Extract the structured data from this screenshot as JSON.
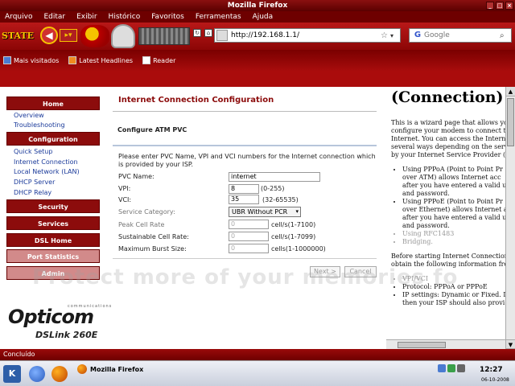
{
  "window": {
    "title": "Mozilla Firefox"
  },
  "menu": [
    "Arquivo",
    "Editar",
    "Exibir",
    "Histórico",
    "Favoritos",
    "Ferramentas",
    "Ajuda"
  ],
  "toolbar": {
    "logo_text": "STATE",
    "url": "http://192.168.1.1/",
    "search_placeholder": "Google"
  },
  "bookmarks": [
    {
      "label": "Mais visitados",
      "icon": "bookmark-folder-icon"
    },
    {
      "label": "Latest Headlines",
      "icon": "rss-icon"
    },
    {
      "label": "Reader",
      "icon": "page-icon"
    }
  ],
  "sidebar": {
    "home": "Home",
    "home_links": [
      "Overview",
      "Troubleshooting"
    ],
    "configuration": "Configuration",
    "config_links": [
      "Quick Setup",
      "Internet Connection",
      "Local Network (LAN)",
      "DHCP Server",
      "DHCP Relay"
    ],
    "security": "Security",
    "services": "Services",
    "dsl_home": "DSL Home",
    "port_statistics": "Port Statistics",
    "admin": "Admin"
  },
  "logo": {
    "brand": "Opticom",
    "sub": "communications",
    "model": "DSLink 260E"
  },
  "main": {
    "title": "Internet Connection Configuration",
    "section": "Configure ATM PVC",
    "intro": "Please enter PVC Name, VPI and VCI numbers for the Internet connection which is provided by your ISP.",
    "fields": {
      "pvc_name": {
        "label": "PVC Name:",
        "value": "internet"
      },
      "vpi": {
        "label": "VPI:",
        "value": "8",
        "hint": "(0-255)"
      },
      "vci": {
        "label": "VCI:",
        "value": "35",
        "hint": "(32-65535)"
      },
      "service_category": {
        "label": "Service Category:",
        "value": "UBR Without PCR"
      },
      "peak_cell_rate": {
        "label": "Peak Cell Rate",
        "value": "0",
        "hint": "cell/s(1-7100)"
      },
      "sustainable_cell_rate": {
        "label": "Sustainable Cell Rate:",
        "value": "0",
        "hint": "cell/s(1-7099)"
      },
      "max_burst_size": {
        "label": "Maximum Burst Size:",
        "value": "0",
        "hint": "cells(1-1000000)"
      }
    },
    "next_button": "Next >",
    "cancel_button": "Cancel"
  },
  "watermark": "Protect more of your memories fo",
  "help": {
    "title": "(Connection)",
    "para1": [
      "This is a wizard page that allows you to",
      "configure your modem to connect to th",
      "Internet.  You can access the Internet in",
      "several ways depending on the service",
      "by your Internet Service Provider (ISP"
    ],
    "bullets1": [
      [
        "Using PPPoA (Point to Point Pr",
        "over ATM) allows Internet acc",
        "after you have entered a valid us",
        "and password."
      ],
      [
        "Using PPPoE (Point to Point Pr",
        "over Ethernet) allows Internet ac",
        "after you have entered a valid us",
        "and password."
      ],
      [
        "Using RFC1483"
      ],
      [
        "Bridging."
      ]
    ],
    "para2": [
      "Before starting Internet Connection, ple",
      "obtain the following information from"
    ],
    "bullets2": [
      [
        "VPI/VCI"
      ],
      [
        "Protocol: PPPoA or PPPoE"
      ],
      [
        "IP settings: Dynamic or Fixed. If",
        "then your ISP should also provi"
      ]
    ]
  },
  "status": "Concluído",
  "taskbar": {
    "task": "Mozilla Firefox",
    "clock": "12:27",
    "date": "06-10-2008"
  }
}
